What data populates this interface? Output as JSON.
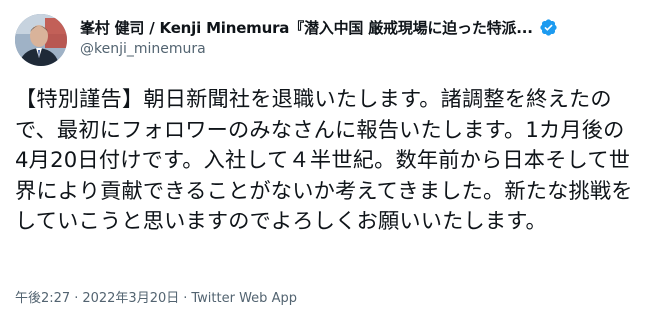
{
  "author": {
    "display_name": "峯村 健司 / Kenji Minemura『潜入中国 厳戒現場に迫った特派...",
    "handle": "@kenji_minemura",
    "verified": true
  },
  "tweet": {
    "text": "【特別謹告】朝日新聞社を退職いたします。諸調整を終えたので、最初にフォロワーのみなさんに報告いたします。1カ月後の4月20日付けです。入社して４半世紀。数年前から日本そして世界により貢献できることがないか考えてきました。新たな挑戦をしていこうと思いますのでよろしくお願いいたします。",
    "time": "午後2:27",
    "separator": "·",
    "date": "2022年3月20日",
    "source": "Twitter Web App"
  },
  "colors": {
    "text_primary": "#0f1419",
    "text_secondary": "#536471",
    "verified_blue": "#1d9bf0"
  },
  "icons": {
    "verified": "verified-badge-icon",
    "more": "more-icon"
  }
}
